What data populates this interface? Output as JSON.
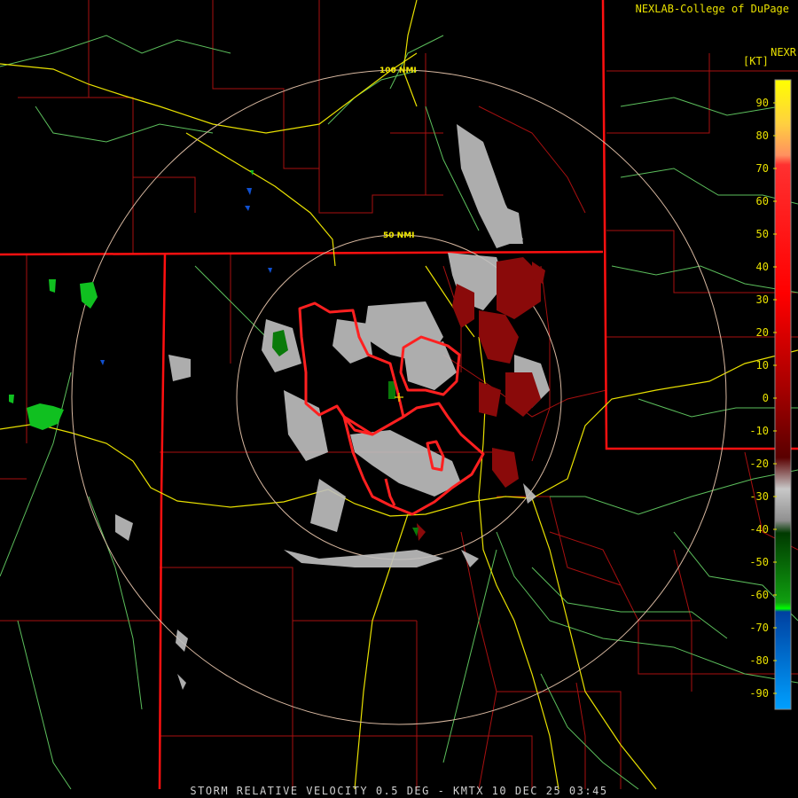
{
  "header": {
    "credit": "NEXLAB-College of DuPage",
    "product_label": "NEXR",
    "unit_label": "[KT]"
  },
  "map": {
    "range_rings": [
      {
        "label": "50 NMI"
      },
      {
        "label": "100 NMI"
      }
    ]
  },
  "legend": {
    "ticks": [
      "90",
      "80",
      "70",
      "60",
      "50",
      "40",
      "30",
      "20",
      "10",
      "0",
      "-10",
      "-20",
      "-30",
      "-40",
      "-50",
      "-60",
      "-70",
      "-80",
      "-90"
    ]
  },
  "colors": {
    "background": "#000000",
    "county_lines": "#b01010",
    "state_lines": "#ff1010",
    "highways": "#e8e000",
    "rivers_roads": "#60c060",
    "range_rings": "#d8b8a0",
    "warning_polygon": "#ff2020",
    "text": "#e8e000"
  },
  "footer": {
    "caption": "STORM RELATIVE VELOCITY 0.5 DEG - KMTX 10 DEC 25 03:45"
  }
}
